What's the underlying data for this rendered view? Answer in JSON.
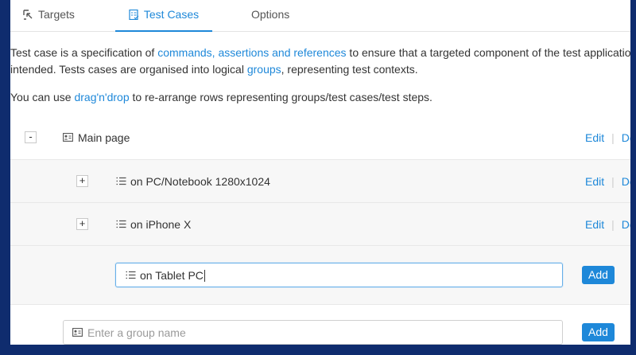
{
  "tabs": [
    {
      "label": "Targets",
      "icon": "crosshair-icon",
      "active": false
    },
    {
      "label": "Test Cases",
      "icon": "checklist-doc-icon",
      "active": true
    },
    {
      "label": "Options",
      "active": false
    }
  ],
  "intro": {
    "p1_a": "Test case is a specification of ",
    "p1_link": "commands, assertions and references",
    "p1_b": " to ensure that a targeted component of the test applicatio",
    "p2_a": "intended. Tests cases are organised into logical ",
    "p2_link": "groups",
    "p2_b": ", representing test contexts.",
    "p3_a": "You can use ",
    "p3_link": "drag'n'drop",
    "p3_b": " to re-arrange rows representing groups/test cases/test steps."
  },
  "group": {
    "toggle": "-",
    "icon": "id-card-icon",
    "label": "Main page",
    "edit": "Edit",
    "delete": "De"
  },
  "test_cases": [
    {
      "toggle": "+",
      "icon": "list-icon",
      "label": "on PC/Notebook 1280x1024",
      "edit": "Edit",
      "delete": "De"
    },
    {
      "toggle": "+",
      "icon": "list-icon",
      "label": "on iPhone X",
      "edit": "Edit",
      "delete": "De"
    }
  ],
  "new_test_case": {
    "icon": "list-icon",
    "value": "on Tablet PC",
    "button": "Add"
  },
  "new_group": {
    "icon": "id-card-icon",
    "placeholder": "Enter a group name",
    "button": "Add"
  },
  "colors": {
    "accent": "#1e88d9",
    "border": "#e3e3e3",
    "row_bg": "#f7f7f7"
  }
}
